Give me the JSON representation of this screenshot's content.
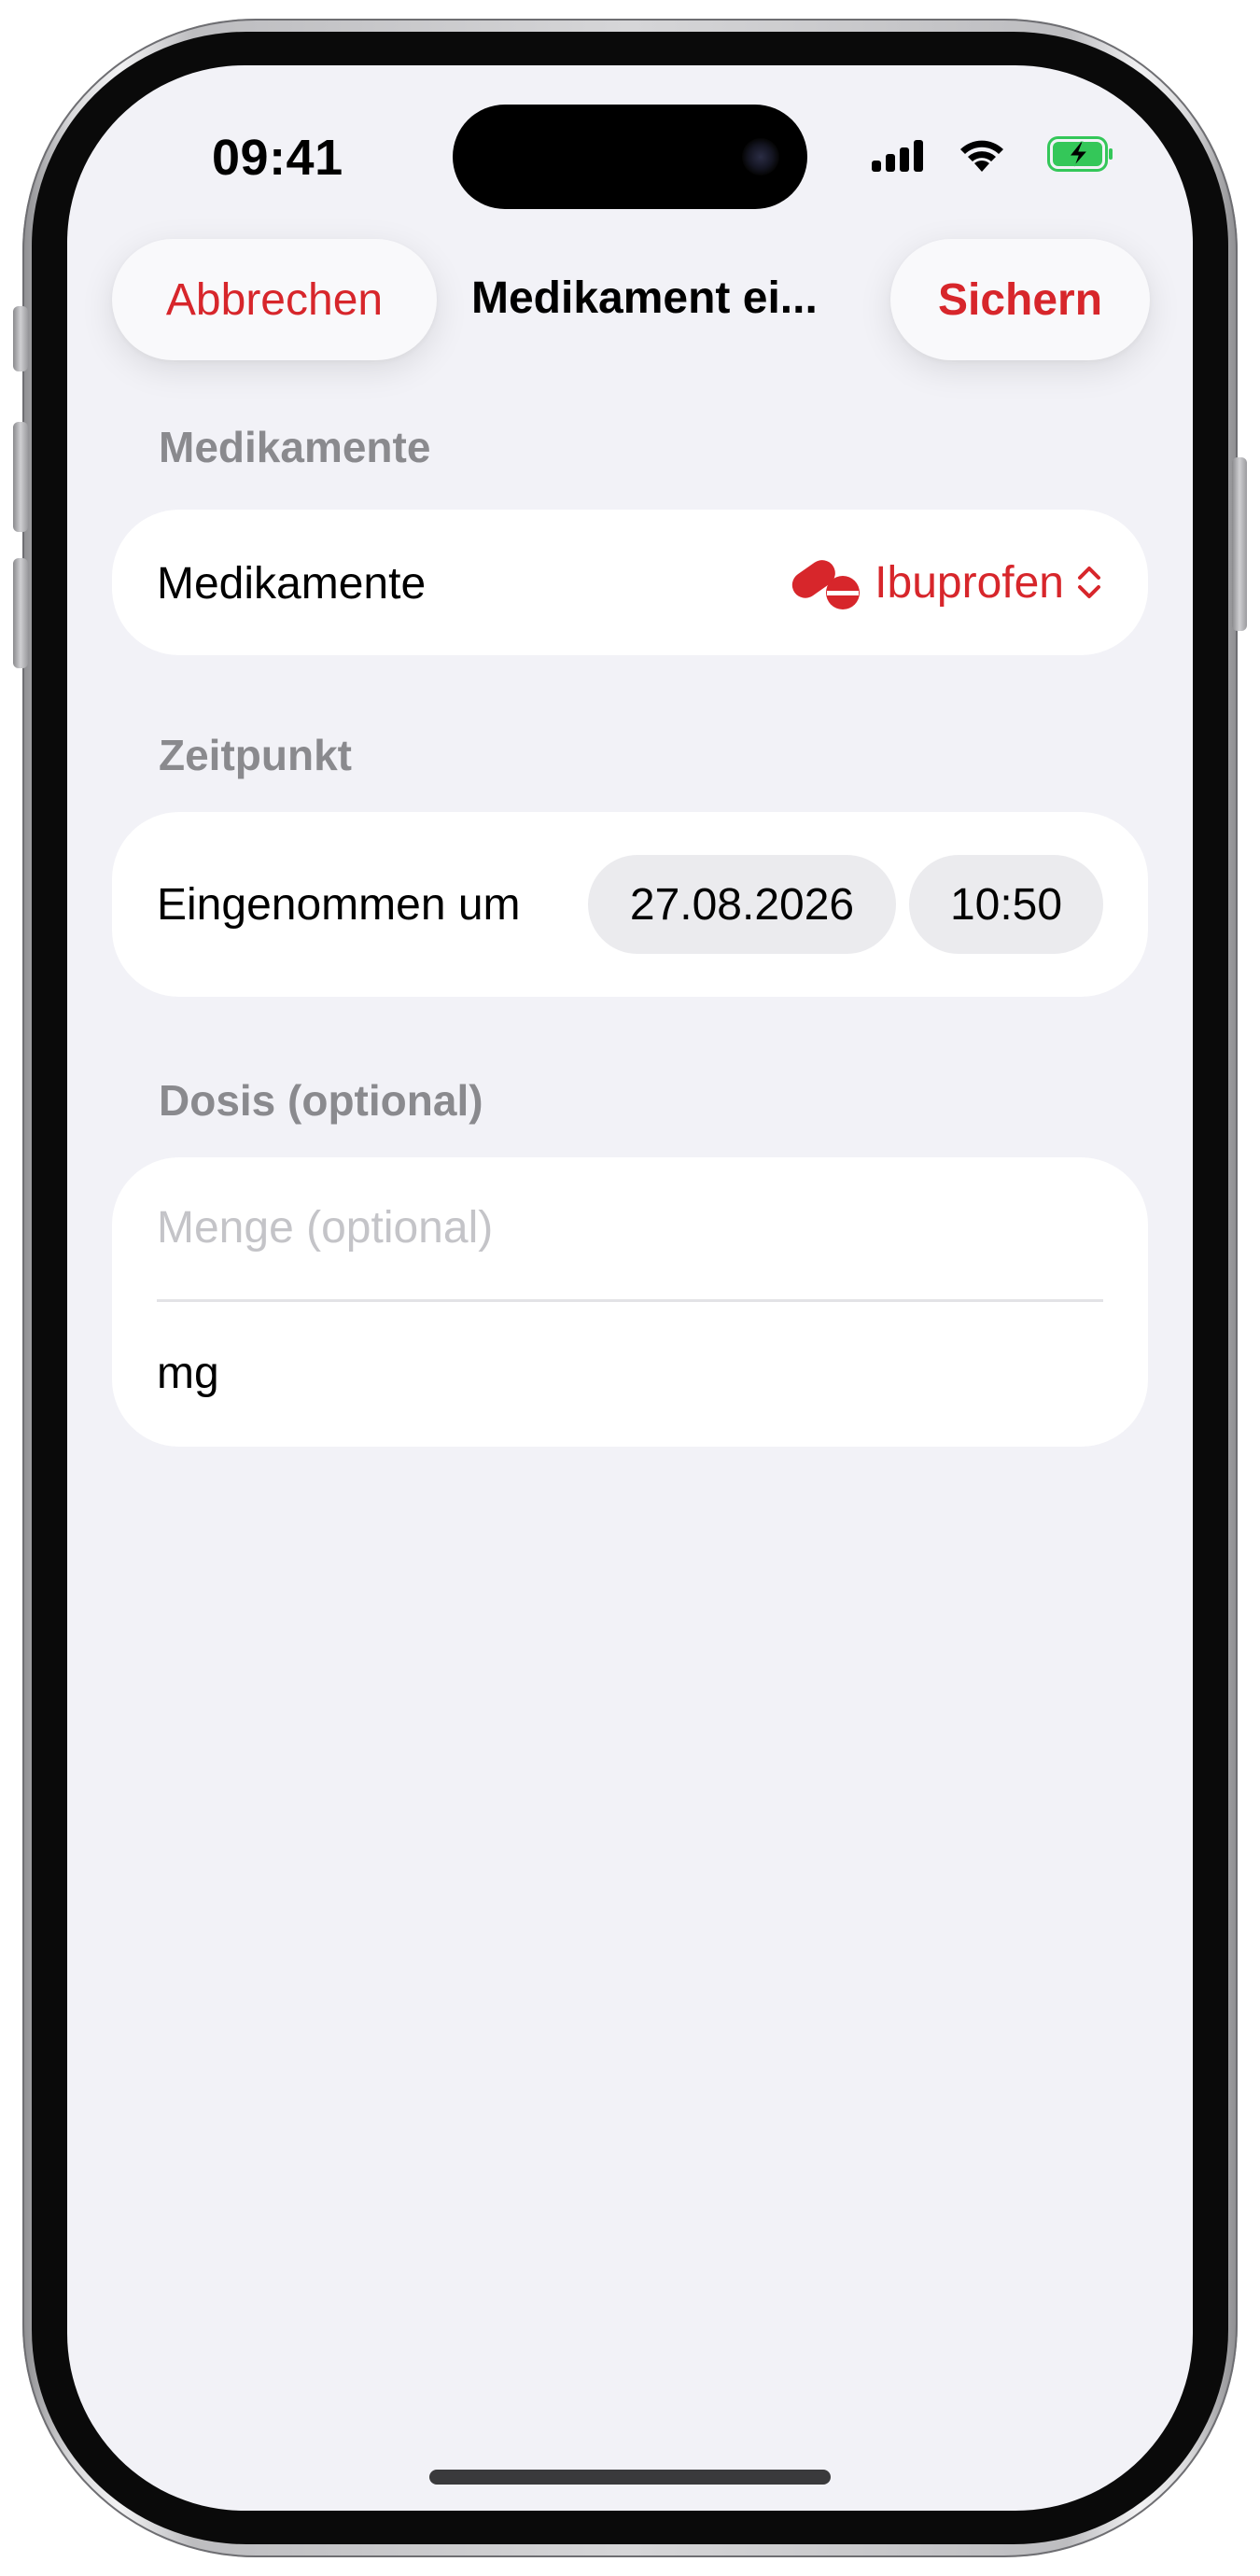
{
  "status_bar": {
    "time": "09:41"
  },
  "nav": {
    "cancel_label": "Abbrechen",
    "title": "Medikament ei...",
    "save_label": "Sichern"
  },
  "sections": {
    "medication": {
      "header": "Medikamente",
      "row_label": "Medikamente",
      "selected_value": "Ibuprofen",
      "icon": "pills-icon",
      "picker_icon": "chevron-up-down-icon"
    },
    "time": {
      "header": "Zeitpunkt",
      "row_label": "Eingenommen um",
      "date": "27.08.2026",
      "time": "10:50"
    },
    "dose": {
      "header": "Dosis (optional)",
      "amount_placeholder": "Menge (optional)",
      "unit": "mg"
    }
  },
  "colors": {
    "accent": "#d7262b",
    "background": "#f2f2f7",
    "card": "#ffffff",
    "secondary_text": "#8a8a8e",
    "placeholder": "#c4c4c8",
    "battery_green": "#34c759"
  }
}
